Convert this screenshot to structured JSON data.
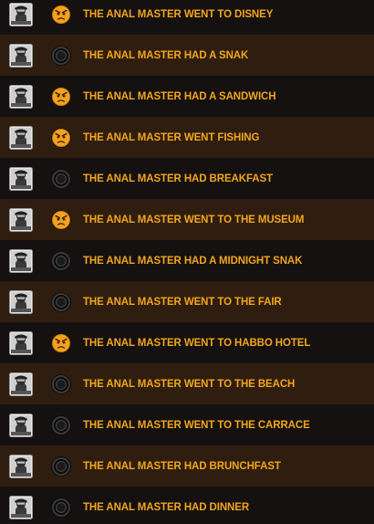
{
  "colors": {
    "row_dark": "#141110",
    "row_brown": "#2f1e10",
    "label_text": "#f2a51c",
    "achieved_face": "#f0a020",
    "locked_ring": "#2a2a2a"
  },
  "items": [
    {
      "label": "THE ANAL MASTER WENT TO DISNEY",
      "status": "achieved",
      "avatar_icon": "user-avatar-icon",
      "status_icon": "angry-face-icon"
    },
    {
      "label": "THE ANAL MASTER HAD A SNAK",
      "status": "locked",
      "avatar_icon": "user-avatar-icon",
      "status_icon": "locked-circle-icon"
    },
    {
      "label": "THE ANAL MASTER HAD A SANDWICH",
      "status": "achieved",
      "avatar_icon": "user-avatar-icon",
      "status_icon": "angry-face-icon"
    },
    {
      "label": "THE ANAL MASTER WENT FISHING",
      "status": "achieved",
      "avatar_icon": "user-avatar-icon",
      "status_icon": "angry-face-icon"
    },
    {
      "label": "THE ANAL MASTER HAD BREAKFAST",
      "status": "locked",
      "avatar_icon": "user-avatar-icon",
      "status_icon": "locked-circle-icon"
    },
    {
      "label": "THE ANAL MASTER WENT TO THE MUSEUM",
      "status": "achieved",
      "avatar_icon": "user-avatar-icon",
      "status_icon": "angry-face-icon"
    },
    {
      "label": "THE ANAL MASTER HAD A MIDNIGHT SNAK",
      "status": "locked",
      "avatar_icon": "user-avatar-icon",
      "status_icon": "locked-circle-icon"
    },
    {
      "label": "THE ANAL MASTER WENT TO THE FAIR",
      "status": "locked",
      "avatar_icon": "user-avatar-icon",
      "status_icon": "locked-circle-icon"
    },
    {
      "label": "THE ANAL MASTER WENT TO HABBO HOTEL",
      "status": "achieved",
      "avatar_icon": "user-avatar-icon",
      "status_icon": "angry-face-icon"
    },
    {
      "label": "THE ANAL MASTER WENT TO THE BEACH",
      "status": "locked",
      "avatar_icon": "user-avatar-icon",
      "status_icon": "locked-circle-icon"
    },
    {
      "label": "THE ANAL MASTER WENT TO THE CARRACE",
      "status": "locked",
      "avatar_icon": "user-avatar-icon",
      "status_icon": "locked-circle-icon"
    },
    {
      "label": "THE ANAL MASTER HAD BRUNCHFAST",
      "status": "locked",
      "avatar_icon": "user-avatar-icon",
      "status_icon": "locked-circle-icon"
    },
    {
      "label": "THE ANAL MASTER HAD DINNER",
      "status": "locked",
      "avatar_icon": "user-avatar-icon",
      "status_icon": "locked-circle-icon"
    }
  ]
}
